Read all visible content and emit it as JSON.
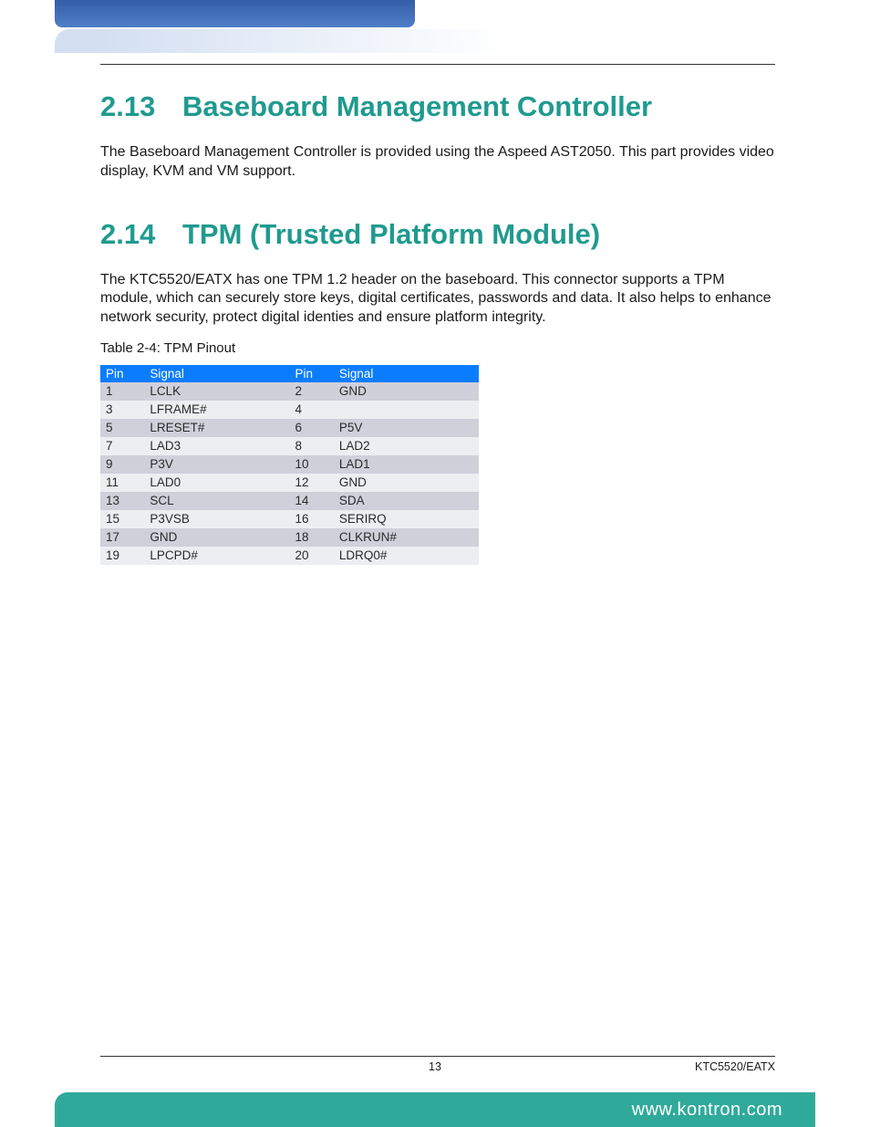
{
  "sections": {
    "s1": {
      "number": "2.13",
      "title": "Baseboard Management Controller",
      "body": "The Baseboard Management Controller is provided using the Aspeed AST2050. This part provides video display, KVM and VM support."
    },
    "s2": {
      "number": "2.14",
      "title": "TPM (Trusted Platform Module)",
      "body": "The KTC5520/EATX has one TPM 1.2  header on the baseboard. This connector supports a TPM module, which can securely store keys, digital certificates, passwords and data. It also helps to enhance network security, protect digital identies and ensure platform integrity."
    }
  },
  "table": {
    "caption": "Table 2-4: TPM Pinout",
    "headers": {
      "pin": "Pin",
      "signal": "Signal"
    },
    "rows": [
      {
        "pinA": "1",
        "sigA": "LCLK",
        "pinB": "2",
        "sigB": "GND"
      },
      {
        "pinA": "3",
        "sigA": "LFRAME#",
        "pinB": "4",
        "sigB": ""
      },
      {
        "pinA": "5",
        "sigA": "LRESET#",
        "pinB": "6",
        "sigB": "P5V"
      },
      {
        "pinA": "7",
        "sigA": "LAD3",
        "pinB": "8",
        "sigB": "LAD2"
      },
      {
        "pinA": "9",
        "sigA": "P3V",
        "pinB": "10",
        "sigB": "LAD1"
      },
      {
        "pinA": "11",
        "sigA": "LAD0",
        "pinB": "12",
        "sigB": "GND"
      },
      {
        "pinA": "13",
        "sigA": "SCL",
        "pinB": "14",
        "sigB": "SDA"
      },
      {
        "pinA": "15",
        "sigA": "P3VSB",
        "pinB": "16",
        "sigB": "SERIRQ"
      },
      {
        "pinA": "17",
        "sigA": "GND",
        "pinB": "18",
        "sigB": "CLKRUN#"
      },
      {
        "pinA": "19",
        "sigA": "LPCPD#",
        "pinB": "20",
        "sigB": "LDRQ0#"
      }
    ]
  },
  "footer": {
    "page": "13",
    "doc_id": "KTC5520/EATX",
    "url": "www.kontron.com"
  }
}
